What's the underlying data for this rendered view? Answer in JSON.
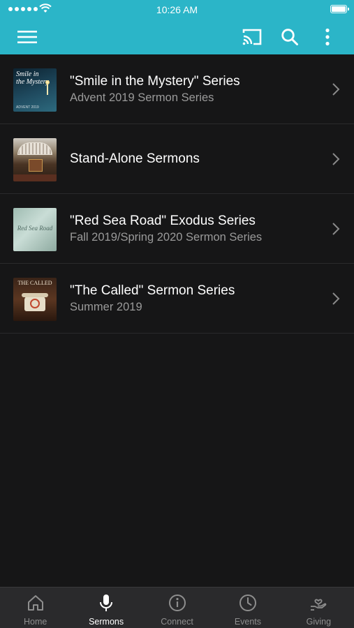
{
  "status_bar": {
    "time": "10:26 AM"
  },
  "colors": {
    "accent": "#2bb5c8",
    "background": "#161617",
    "tab_bar": "#2a2a2c",
    "subtitle": "#9a9a9a"
  },
  "app_bar": {
    "icons": [
      "menu-icon",
      "cast-icon",
      "search-icon",
      "more-vertical-icon"
    ]
  },
  "series": [
    {
      "title": "\"Smile in the Mystery\" Series",
      "subtitle": "Advent 2019 Sermon Series",
      "thumb_text": [
        "Smile in",
        "the Mystery",
        "ADVENT 2019"
      ]
    },
    {
      "title": "Stand-Alone Sermons",
      "subtitle": ""
    },
    {
      "title": "\"Red Sea Road\" Exodus Series",
      "subtitle": "Fall 2019/Spring 2020 Sermon Series",
      "thumb_text": [
        "Red Sea Road"
      ]
    },
    {
      "title": "\"The Called\" Sermon Series",
      "subtitle": "Summer 2019",
      "thumb_text": [
        "THE CALLED"
      ]
    }
  ],
  "tabs": [
    {
      "label": "Home",
      "icon": "home-icon",
      "active": false
    },
    {
      "label": "Sermons",
      "icon": "microphone-icon",
      "active": true
    },
    {
      "label": "Connect",
      "icon": "info-icon",
      "active": false
    },
    {
      "label": "Events",
      "icon": "clock-icon",
      "active": false
    },
    {
      "label": "Giving",
      "icon": "giving-hand-icon",
      "active": false
    }
  ]
}
